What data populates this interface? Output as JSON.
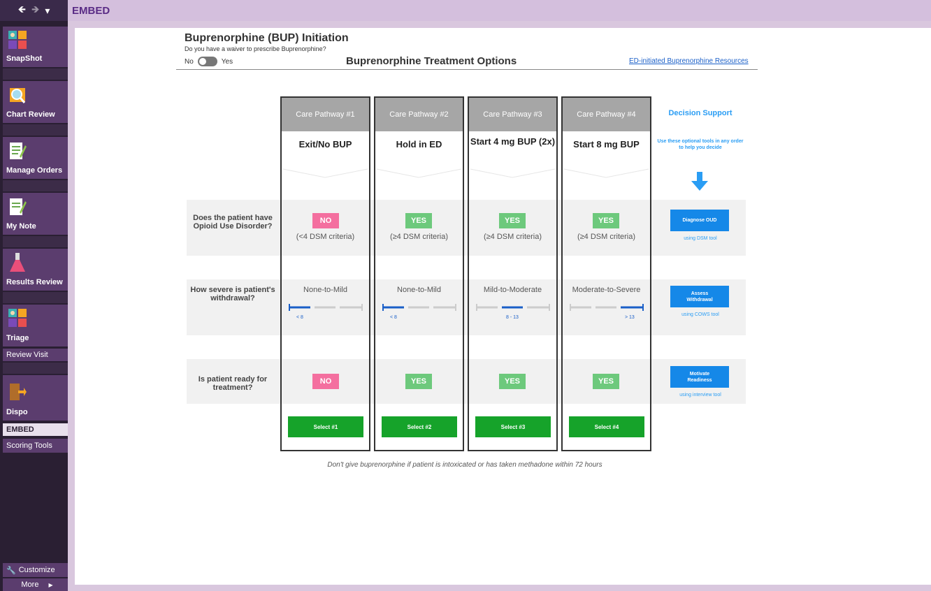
{
  "window": {
    "title": "EMBED",
    "nav": {
      "back": "🡸",
      "forward": "🡺",
      "menu": "▾"
    }
  },
  "sidebar": {
    "items": [
      {
        "label": "SnapShot",
        "icon": "snapshot-icon"
      },
      {
        "label": "Chart Review",
        "icon": "chart-review-icon"
      },
      {
        "label": "Manage Orders",
        "icon": "manage-orders-icon"
      },
      {
        "label": "My Note",
        "icon": "note-icon"
      },
      {
        "label": "Results Review",
        "icon": "flask-icon"
      },
      {
        "label": "Triage",
        "icon": "triage-icon"
      },
      {
        "label": "Review Visit"
      },
      {
        "label": "Dispo",
        "icon": "door-exit-icon"
      },
      {
        "label": "EMBED"
      },
      {
        "label": "Scoring Tools"
      }
    ],
    "customize": "Customize",
    "more": "More"
  },
  "header": {
    "title": "Buprenorphine (BUP) Initiation",
    "waiver_question": "Do you have a waiver to prescribe Buprenorphine?",
    "toggle_no": "No",
    "toggle_yes": "Yes",
    "main_title": "Buprenorphine Treatment Options",
    "resources_link": "ED-initiated Buprenorphine Resources"
  },
  "questions": {
    "q1": "Does the patient have Opioid Use Disorder?",
    "q2": "How severe is patient's withdrawal?",
    "q3": "Is patient ready for treatment?"
  },
  "pathways": [
    {
      "header": "Care Pathway #1",
      "title": "Exit/No BUP",
      "oud": "NO",
      "oud_crit": "(<4 DSM criteria)",
      "severity": "None-to-Mild",
      "range": "< 8",
      "ready": "NO",
      "select": "Select #1"
    },
    {
      "header": "Care Pathway #2",
      "title": "Hold in ED",
      "oud": "YES",
      "oud_crit": "(≥4 DSM criteria)",
      "severity": "None-to-Mild",
      "range": "< 8",
      "ready": "YES",
      "select": "Select #2"
    },
    {
      "header": "Care Pathway #3",
      "title": "Start 4 mg BUP (2x)",
      "oud": "YES",
      "oud_crit": "(≥4 DSM criteria)",
      "severity": "Mild-to-Moderate",
      "range": "8 - 13",
      "ready": "YES",
      "select": "Select #3"
    },
    {
      "header": "Care Pathway #4",
      "title": "Start 8 mg BUP",
      "oud": "YES",
      "oud_crit": "(≥4 DSM criteria)",
      "severity": "Moderate-to-Severe",
      "range": "> 13",
      "ready": "YES",
      "select": "Select #4"
    }
  ],
  "decision_support": {
    "title": "Decision Support",
    "subtitle": "Use these optional tools in any order to help you decide",
    "tools": [
      {
        "button": "Diagnose OUD",
        "link": "using DSM tool"
      },
      {
        "button": "Assess Withdrawal",
        "link": "using COWS tool"
      },
      {
        "button": "Motivate Readiness",
        "link": "using interview tool"
      }
    ]
  },
  "footer_warning": "Don't give buprenorphine if patient is intoxicated or has taken methadone within 72 hours",
  "colors": {
    "purple": "#5b3d6e",
    "no": "#f46f9f",
    "yes": "#6dc97c",
    "select": "#16a32a",
    "tool": "#1588e8",
    "link": "#1a5fc8"
  }
}
